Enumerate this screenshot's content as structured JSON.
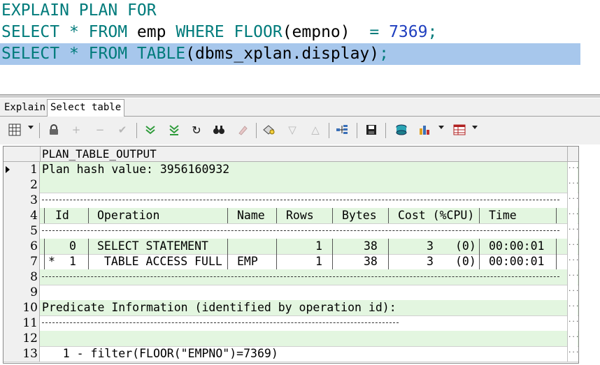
{
  "editor": {
    "line1": {
      "kw1": "EXPLAIN",
      "kw2": "PLAN",
      "kw3": "FOR"
    },
    "line2": {
      "kw1": "SELECT",
      "star": "*",
      "kw2": "FROM",
      "table": "emp",
      "kw3": "WHERE",
      "fn": "FLOOR",
      "open": "(",
      "col": "empno",
      "close": ")",
      "eq": "=",
      "value": "7369",
      "semi": ";"
    },
    "line3": {
      "kw1": "SELECT",
      "star": "*",
      "kw2": "FROM",
      "kw3": "TABLE",
      "open": "(",
      "call": "dbms_xplan.display",
      "close": ")",
      "semi": ";"
    }
  },
  "tabs": [
    {
      "label": "Explain"
    },
    {
      "label": "Select table"
    }
  ],
  "toolbar_icons": [
    "grid-icon",
    "lock-icon",
    "add-icon",
    "remove-icon",
    "check-icon",
    "fetch-next-icon",
    "fetch-last-icon",
    "refresh-icon",
    "find-icon",
    "clear-icon",
    "query-icon",
    "down-icon",
    "up-icon",
    "tree-icon",
    "save-icon",
    "export-icon",
    "chart-icon",
    "table-icon"
  ],
  "grid": {
    "column": "PLAN_TABLE_OUTPUT",
    "rows": [
      {
        "n": "1",
        "text": "Plan hash value: 3956160932"
      },
      {
        "n": "2",
        "text": ""
      },
      {
        "n": "3",
        "text": ""
      },
      {
        "n": "4",
        "text": ""
      },
      {
        "n": "5",
        "text": ""
      },
      {
        "n": "6",
        "text": ""
      },
      {
        "n": "7",
        "text": ""
      },
      {
        "n": "8",
        "text": ""
      },
      {
        "n": "9",
        "text": ""
      },
      {
        "n": "10",
        "text": "Predicate Information (identified by operation id):"
      },
      {
        "n": "11",
        "text": ""
      },
      {
        "n": "12",
        "text": ""
      },
      {
        "n": "13",
        "text": "   1 - filter(FLOOR(\"EMPNO\")=7369)"
      }
    ],
    "plan_header": {
      "id": "Id",
      "operation": "Operation",
      "name": "Name",
      "rows": "Rows",
      "bytes": "Bytes",
      "cost": "Cost (%CPU)",
      "time": "Time"
    },
    "plan_rows": [
      {
        "star": "",
        "id": "0",
        "operation": "SELECT STATEMENT",
        "name": "",
        "rows": "1",
        "bytes": "38",
        "cost": "3",
        "cpu": "(0)",
        "time": "00:00:01"
      },
      {
        "star": "*",
        "id": "1",
        "operation": " TABLE ACCESS FULL",
        "name": "EMP",
        "rows": "1",
        "bytes": "38",
        "cost": "3",
        "cpu": "(0)",
        "time": "00:00:01"
      }
    ],
    "dots": "..."
  }
}
